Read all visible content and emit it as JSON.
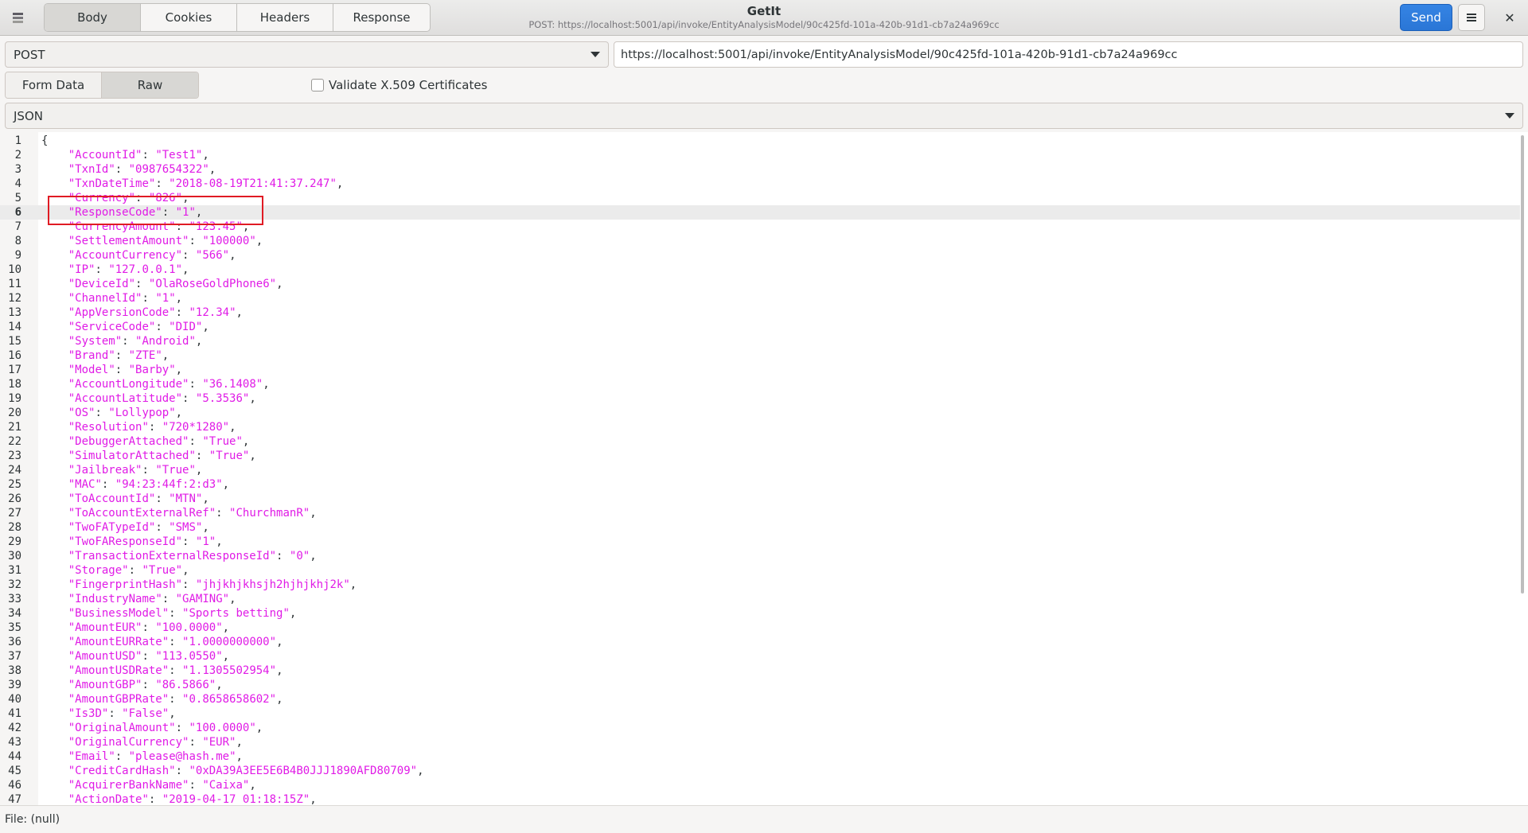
{
  "header": {
    "title": "GetIt",
    "subtitle": "POST: https://localhost:5001/api/invoke/EntityAnalysisModel/90c425fd-101a-420b-91d1-cb7a24a969cc",
    "tabs": [
      "Body",
      "Cookies",
      "Headers",
      "Response"
    ],
    "active_tab": "Body",
    "send_label": "Send",
    "close_glyph": "✕",
    "app_icon": "app-stack-icon",
    "menu_icon": "hamburger-menu-icon"
  },
  "request": {
    "method": "POST",
    "url": "https://localhost:5001/api/invoke/EntityAnalysisModel/90c425fd-101a-420b-91d1-cb7a24a969cc"
  },
  "body_mode": {
    "options": [
      "Form Data",
      "Raw"
    ],
    "active": "Raw",
    "validate_label": "Validate X.509 Certificates",
    "validate_checked": false
  },
  "content_type": "JSON",
  "editor": {
    "current_line": 6,
    "highlighted_line": 6,
    "highlight_color": "#e01b24",
    "string_color": "#e01be6",
    "open_brace": "{",
    "lines": [
      {
        "key": "AccountId",
        "value": "Test1"
      },
      {
        "key": "TxnId",
        "value": "0987654322"
      },
      {
        "key": "TxnDateTime",
        "value": "2018-08-19T21:41:37.247"
      },
      {
        "key": "Currency",
        "value": "826"
      },
      {
        "key": "ResponseCode",
        "value": "1"
      },
      {
        "key": "CurrencyAmount",
        "value": "123.45"
      },
      {
        "key": "SettlementAmount",
        "value": "100000"
      },
      {
        "key": "AccountCurrency",
        "value": "566"
      },
      {
        "key": "IP",
        "value": "127.0.0.1"
      },
      {
        "key": "DeviceId",
        "value": "OlaRoseGoldPhone6"
      },
      {
        "key": "ChannelId",
        "value": "1"
      },
      {
        "key": "AppVersionCode",
        "value": "12.34"
      },
      {
        "key": "ServiceCode",
        "value": "DID"
      },
      {
        "key": "System",
        "value": "Android"
      },
      {
        "key": "Brand",
        "value": "ZTE"
      },
      {
        "key": "Model",
        "value": "Barby"
      },
      {
        "key": "AccountLongitude",
        "value": "36.1408"
      },
      {
        "key": "AccountLatitude",
        "value": "5.3536"
      },
      {
        "key": "OS",
        "value": "Lollypop"
      },
      {
        "key": "Resolution",
        "value": "720*1280"
      },
      {
        "key": "DebuggerAttached",
        "value": "True"
      },
      {
        "key": "SimulatorAttached",
        "value": "True"
      },
      {
        "key": "Jailbreak",
        "value": "True"
      },
      {
        "key": "MAC",
        "value": "94:23:44f:2:d3"
      },
      {
        "key": "ToAccountId",
        "value": "MTN"
      },
      {
        "key": "ToAccountExternalRef",
        "value": "ChurchmanR"
      },
      {
        "key": "TwoFATypeId",
        "value": "SMS"
      },
      {
        "key": "TwoFAResponseId",
        "value": "1"
      },
      {
        "key": "TransactionExternalResponseId",
        "value": "0"
      },
      {
        "key": "Storage",
        "value": "True"
      },
      {
        "key": "FingerprintHash",
        "value": "jhjkhjkhsjh2hjhjkhj2k"
      },
      {
        "key": "IndustryName",
        "value": "GAMING"
      },
      {
        "key": "BusinessModel",
        "value": "Sports betting"
      },
      {
        "key": "AmountEUR",
        "value": "100.0000"
      },
      {
        "key": "AmountEURRate",
        "value": "1.0000000000"
      },
      {
        "key": "AmountUSD",
        "value": "113.0550"
      },
      {
        "key": "AmountUSDRate",
        "value": "1.1305502954"
      },
      {
        "key": "AmountGBP",
        "value": "86.5866"
      },
      {
        "key": "AmountGBPRate",
        "value": "0.8658658602"
      },
      {
        "key": "Is3D",
        "value": "False"
      },
      {
        "key": "OriginalAmount",
        "value": "100.0000"
      },
      {
        "key": "OriginalCurrency",
        "value": "EUR"
      },
      {
        "key": "Email",
        "value": "please@hash.me"
      },
      {
        "key": "CreditCardHash",
        "value": "0xDA39A3EE5E6B4B0JJJ1890AFD80709"
      },
      {
        "key": "AcquirerBankName",
        "value": "Caixa"
      },
      {
        "key": "ActionDate",
        "value": "2019-04-17 01:18:15Z"
      }
    ]
  },
  "status": "File: (null)"
}
